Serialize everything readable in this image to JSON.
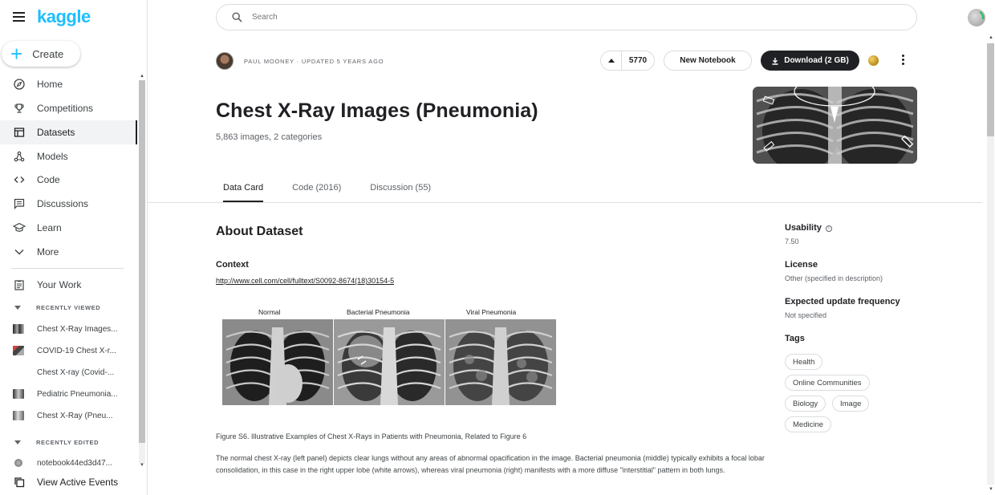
{
  "brand": {
    "logo_text": "kaggle",
    "accent": "#20beff"
  },
  "sidebar": {
    "create_label": "Create",
    "nav": [
      {
        "label": "Home",
        "icon": "compass-icon"
      },
      {
        "label": "Competitions",
        "icon": "trophy-icon"
      },
      {
        "label": "Datasets",
        "icon": "table-icon",
        "active": true
      },
      {
        "label": "Models",
        "icon": "models-icon"
      },
      {
        "label": "Code",
        "icon": "code-icon"
      },
      {
        "label": "Discussions",
        "icon": "discussion-icon"
      },
      {
        "label": "Learn",
        "icon": "school-icon"
      },
      {
        "label": "More",
        "icon": "chevron-down-icon"
      }
    ],
    "your_work_label": "Your Work",
    "recently_viewed_label": "RECENTLY VIEWED",
    "recently_viewed": [
      "Chest X-Ray Images...",
      "COVID-19 Chest X-r...",
      "Chest X-ray (Covid-...",
      "Pediatric Pneumonia...",
      "Chest X-Ray (Pneu..."
    ],
    "recently_edited_label": "RECENTLY EDITED",
    "recently_edited": [
      "notebook44ed3d47..."
    ],
    "view_active_events_label": "View Active Events"
  },
  "search": {
    "placeholder": "Search"
  },
  "dataset": {
    "author_line": "PAUL MOONEY · UPDATED 5 YEARS AGO",
    "upvotes": "5770",
    "new_notebook_label": "New Notebook",
    "download_label": "Download (2 GB)",
    "title": "Chest X-Ray Images (Pneumonia)",
    "subtitle": "5,863 images, 2 categories"
  },
  "tabs": [
    "Data Card",
    "Code (2016)",
    "Discussion (55)"
  ],
  "content": {
    "about_heading": "About Dataset",
    "context_heading": "Context",
    "context_link": "http://www.cell.com/cell/fulltext/S0092-8674(18)30154-5",
    "figure_labels": [
      "Normal",
      "Bacterial Pneumonia",
      "Viral Pneumonia"
    ],
    "caption": "Figure S6. Illustrative Examples of Chest X-Rays in Patients with Pneumonia, Related to Figure 6",
    "paragraph": "The normal chest X-ray (left panel) depicts clear lungs without any areas of abnormal opacification in the image. Bacterial pneumonia (middle) typically exhibits a focal lobar consolidation, in this case in the right upper lobe (white arrows), whereas viral pneumonia (right) manifests with a more diffuse \"interstitial\" pattern in both lungs."
  },
  "meta": {
    "usability_label": "Usability",
    "usability_value": "7.50",
    "license_label": "License",
    "license_value": "Other (specified in description)",
    "update_label": "Expected update frequency",
    "update_value": "Not specified",
    "tags_label": "Tags",
    "tags": [
      "Health",
      "Online Communities",
      "Biology",
      "Image",
      "Medicine"
    ]
  }
}
